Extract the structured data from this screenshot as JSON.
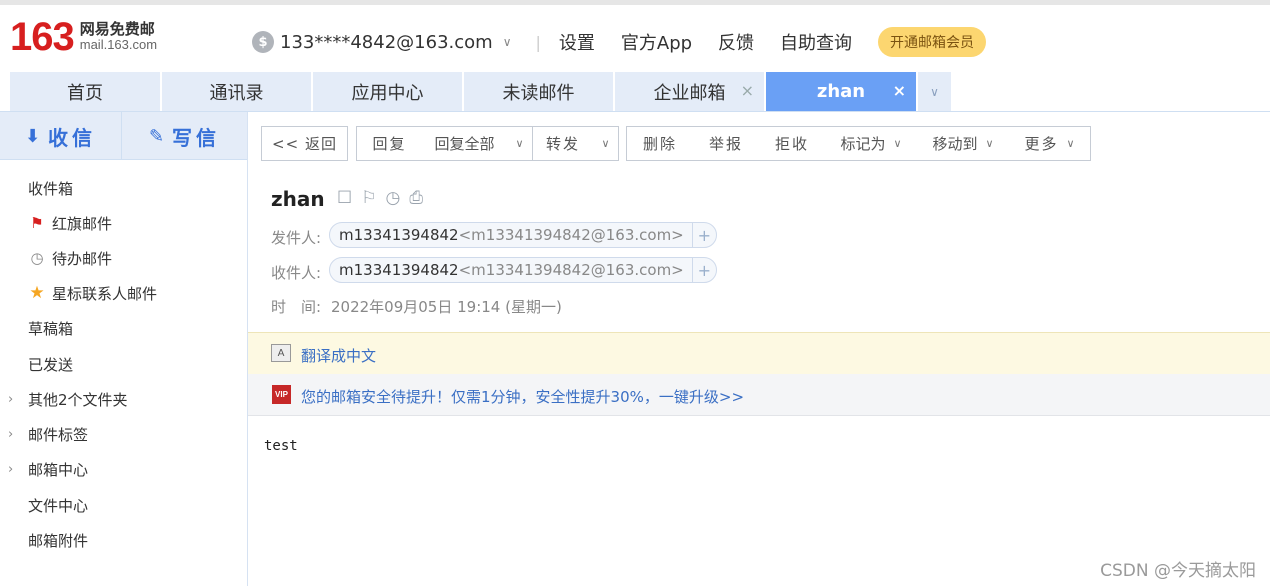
{
  "header": {
    "logo_number": "163",
    "logo_cn": "网易免费邮",
    "logo_en": "mail.163.com",
    "account_icon": "$",
    "account": "133****4842@163.com",
    "links": [
      "设置",
      "官方App",
      "反馈",
      "自助查询"
    ],
    "vip_button": "开通邮箱会员"
  },
  "tabs": [
    {
      "label": "首页",
      "active": false
    },
    {
      "label": "通讯录",
      "active": false
    },
    {
      "label": "应用中心",
      "active": false
    },
    {
      "label": "未读邮件",
      "active": false
    },
    {
      "label": "企业邮箱",
      "active": false,
      "closable": true
    },
    {
      "label": "zhan",
      "active": true,
      "closable": true
    }
  ],
  "sidebar": {
    "receive_label": "收信",
    "compose_label": "写信",
    "folders": [
      {
        "label": "收件箱"
      },
      {
        "label": "红旗邮件",
        "icon": "red-flag-icon"
      },
      {
        "label": "待办邮件",
        "icon": "clock-icon"
      },
      {
        "label": "星标联系人邮件",
        "icon": "star-icon"
      },
      {
        "label": "草稿箱"
      },
      {
        "label": "已发送"
      },
      {
        "label": "其他2个文件夹",
        "expandable": true
      },
      {
        "label": "邮件标签",
        "expandable": true
      },
      {
        "label": "邮箱中心",
        "expandable": true
      },
      {
        "label": "文件中心"
      },
      {
        "label": "邮箱附件"
      }
    ]
  },
  "toolbar": {
    "back": "<< 返回",
    "reply": "回复",
    "reply_all": "回复全部",
    "forward": "转发",
    "delete": "删除",
    "report": "举报",
    "reject": "拒收",
    "mark_as": "标记为",
    "move_to": "移动到",
    "more": "更多"
  },
  "message": {
    "subject": "zhan",
    "from_label": "发件人:",
    "from_name": "m13341394842",
    "from_addr": "<m13341394842@163.com>",
    "to_label": "收件人:",
    "to_name": "m13341394842",
    "to_addr": "<m13341394842@163.com>",
    "time_label": "时　间:",
    "time_value": "2022年09月05日 19:14 (星期一)",
    "translate": "翻译成中文",
    "vip_badge": "VIP",
    "security_notice": "您的邮箱安全待提升！仅需1分钟，安全性提升30%，一键升级>>",
    "body": "test"
  },
  "watermark": "CSDN @今天摘太阳",
  "colors": {
    "brand_red": "#d71f1f",
    "tab_active": "#6aa0f5",
    "tab_bg": "#e4ecf8",
    "link_blue": "#3a6fc4",
    "vip_yellow": "#fcd670"
  }
}
